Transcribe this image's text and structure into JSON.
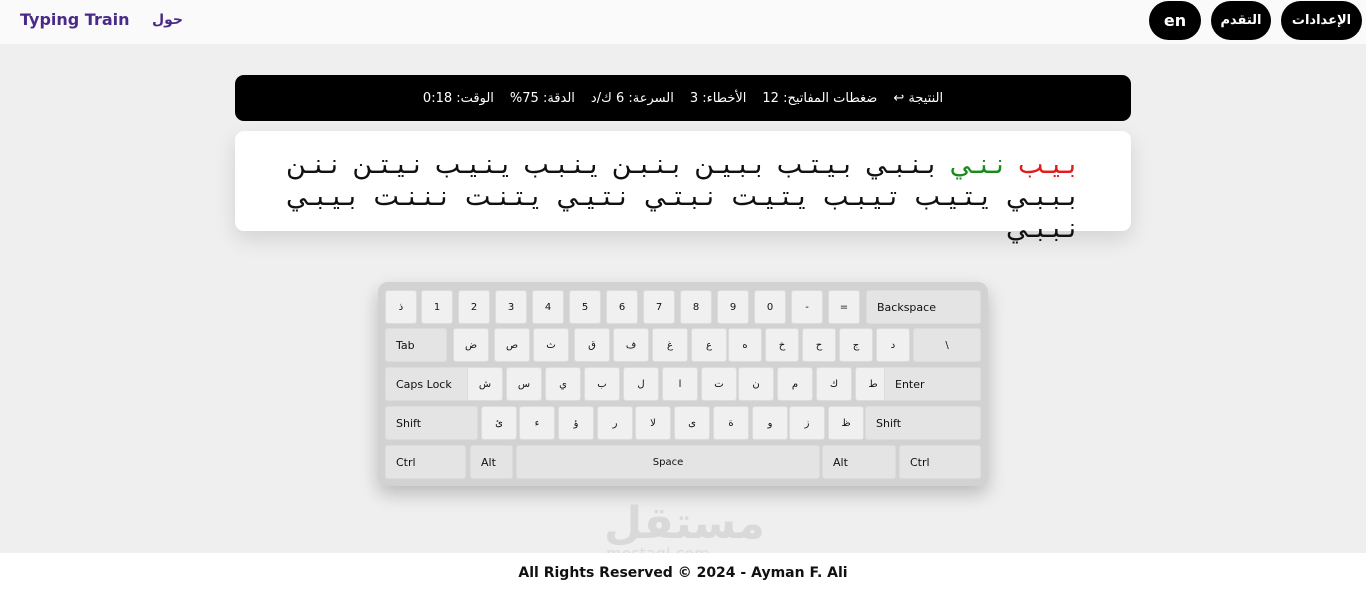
{
  "nav": {
    "brand": "Typing Train",
    "about": "حول",
    "settings": "الإعدادات",
    "progress": "التقدم",
    "language": "en"
  },
  "stats": {
    "result": "النتيجة ↩",
    "keystrokes": "ضغطات المفاتيح: 12",
    "errors": "الأخطاء: 3",
    "speed": "السرعة: 6 ك/د",
    "accuracy": "الدقة: 75%",
    "time": "الوقت: 0:18"
  },
  "practice": {
    "word_error": "بـيـب",
    "word_done": "نـنـي",
    "rest_line1": "بـنـبـي بـيـتـب بـبـيـن بـنـبـن يـنـبـب يـنـيـب نـيـتـن نـنـن",
    "line2": "بـبـبـي يـتـيـب تـيـبـب يـتـيـت نـبـتـي نـتـيـي يـتـنـت نـنـنـت بـيـبـي نـبـبـي"
  },
  "keyboard": {
    "row1": [
      "ذ",
      "1",
      "2",
      "3",
      "4",
      "5",
      "6",
      "7",
      "8",
      "9",
      "0",
      "-",
      "=",
      "Backspace"
    ],
    "row2": [
      "Tab",
      "ض",
      "ص",
      "ث",
      "ق",
      "ف",
      "غ",
      "ع",
      "ه",
      "خ",
      "ح",
      "ج",
      "د",
      "\\"
    ],
    "row3": [
      "Caps Lock",
      "ش",
      "س",
      "ي",
      "ب",
      "ل",
      "ا",
      "ت",
      "ن",
      "م",
      "ك",
      "ط",
      "Enter"
    ],
    "row4": [
      "Shift",
      "ئ",
      "ء",
      "ؤ",
      "ر",
      "لا",
      "ى",
      "ة",
      "و",
      "ز",
      "ظ",
      "Shift"
    ],
    "row5": [
      "Ctrl",
      "Alt",
      "Space",
      "Alt",
      "Ctrl"
    ]
  },
  "watermark": {
    "arabic": "مستقل",
    "latin": "mostaql.com"
  },
  "footer": {
    "copyright": "All Rights Reserved © 2024 - Ayman F. Ali"
  }
}
